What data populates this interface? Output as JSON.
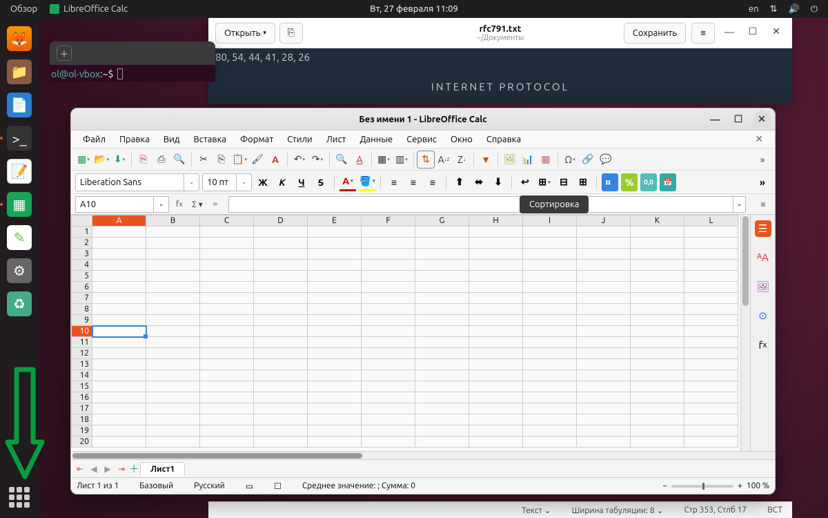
{
  "panel": {
    "activities": "Обзор",
    "app_name": "LibreOffice Calc",
    "datetime": "Вт, 27 февраля  11:09",
    "lang": "en"
  },
  "terminal": {
    "prompt": "ol@ol-vbox",
    "path": ":~$"
  },
  "gedit": {
    "open": "Открыть",
    "title": "rfc791.txt",
    "subtitle": "~/Документы",
    "save": "Сохранить",
    "line1": "80, 54, 44, 41, 28, 26",
    "line2": "INTERNET PROTOCOL",
    "status_text": "Текст",
    "status_tab": "Ширина табуляции: 8",
    "status_pos": "Стр 353, Стлб 17",
    "status_ins": "ВСТ"
  },
  "calc": {
    "title": "Без имени 1 - LibreOffice Calc",
    "menu": [
      "Файл",
      "Правка",
      "Вид",
      "Вставка",
      "Формат",
      "Стили",
      "Лист",
      "Данные",
      "Сервис",
      "Окно",
      "Справка"
    ],
    "font_name": "Liberation Sans",
    "font_size": "10 пт",
    "cell_ref": "A10",
    "selected_row": 10,
    "selected_col": "A",
    "columns": [
      "A",
      "B",
      "C",
      "D",
      "E",
      "F",
      "G",
      "H",
      "I",
      "J",
      "K",
      "L"
    ],
    "rows": [
      1,
      2,
      3,
      4,
      5,
      6,
      7,
      8,
      9,
      10,
      11,
      12,
      13,
      14,
      15,
      16,
      17,
      18,
      19,
      20
    ],
    "sheet_tab": "Лист1",
    "status_sheet": "Лист 1 из 1",
    "status_style": "Базовый",
    "status_lang": "Русский",
    "status_stats": "Среднее значение: ; Сумма: 0",
    "zoom": "100 %",
    "tooltip": "Сортировка",
    "bold": "Ж",
    "italic": "К",
    "underline": "Ч",
    "strike": "S"
  }
}
